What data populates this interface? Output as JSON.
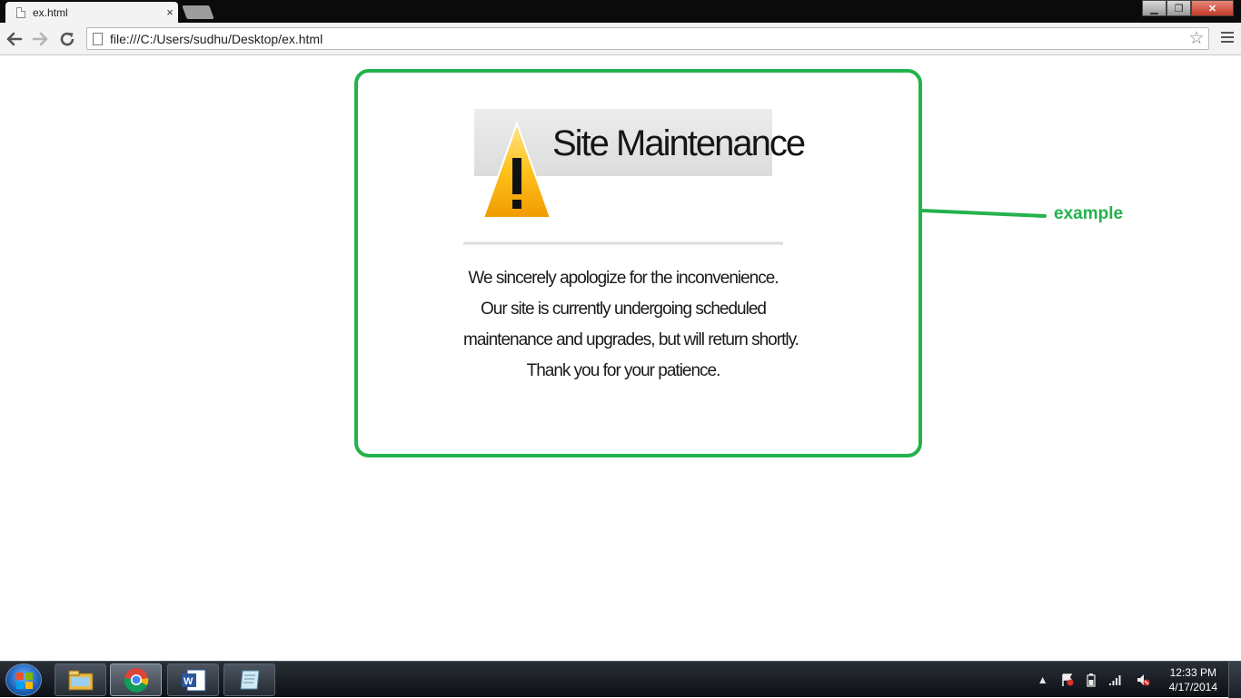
{
  "browser": {
    "tab_title": "ex.html",
    "tab_close": "×",
    "url": "file:///C:/Users/sudhu/Desktop/ex.html",
    "star": "☆",
    "back": "🡐",
    "forward": "🡒",
    "reload": "↻"
  },
  "window_controls": {
    "minimize": "▁",
    "maximize": "❐",
    "close": "✕"
  },
  "page": {
    "maintenance_title": "Site Maintenance",
    "message_lines": [
      "We sincerely apologize for the inconvenience.",
      "Our site is currently undergoing scheduled",
      "maintenance and upgrades, but will return shortly.",
      "Thank you for your patience."
    ],
    "annotation_label": "example",
    "accent_color": "#23b24b"
  },
  "taskbar": {
    "time": "12:33 PM",
    "date": "4/17/2014",
    "items": [
      "file-explorer",
      "google-chrome",
      "microsoft-word",
      "notepad"
    ],
    "tray_icons": [
      "show-hidden-icons",
      "action-center-flag",
      "battery",
      "network-signal",
      "volume-muted"
    ]
  }
}
